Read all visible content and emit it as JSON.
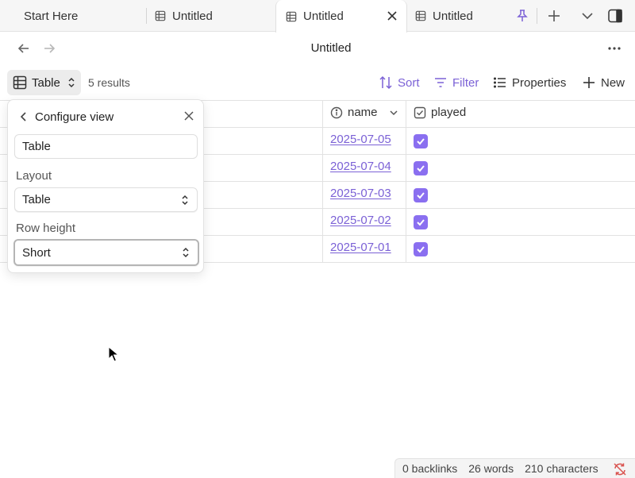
{
  "tabs": [
    {
      "label": "Start Here",
      "icon": "none",
      "active": false
    },
    {
      "label": "Untitled",
      "icon": "table-icon",
      "active": false
    },
    {
      "label": "Untitled",
      "icon": "table-icon",
      "active": true
    },
    {
      "label": "Untitled",
      "icon": "table-icon",
      "active": false
    }
  ],
  "page": {
    "title": "Untitled"
  },
  "toolbar": {
    "view_label": "Table",
    "results": "5 results",
    "sort_label": "Sort",
    "filter_label": "Filter",
    "properties_label": "Properties",
    "new_label": "New"
  },
  "table": {
    "columns": [
      {
        "label": "name",
        "icon": "info-icon"
      },
      {
        "label": "played",
        "icon": "checkbox-icon"
      }
    ],
    "rows": [
      {
        "name": "2025-07-05",
        "played": true
      },
      {
        "name": "2025-07-04",
        "played": true
      },
      {
        "name": "2025-07-03",
        "played": true
      },
      {
        "name": "2025-07-02",
        "played": true
      },
      {
        "name": "2025-07-01",
        "played": true
      }
    ]
  },
  "configure": {
    "title": "Configure view",
    "view_name": "Table",
    "layout_label": "Layout",
    "layout_value": "Table",
    "row_height_label": "Row height",
    "row_height_value": "Short"
  },
  "status": {
    "backlinks": "0 backlinks",
    "words": "26 words",
    "characters": "210 characters"
  },
  "colors": {
    "accent": "#7b61d6",
    "checkbox": "#8a6ff0",
    "sync_error": "#d9534f"
  }
}
